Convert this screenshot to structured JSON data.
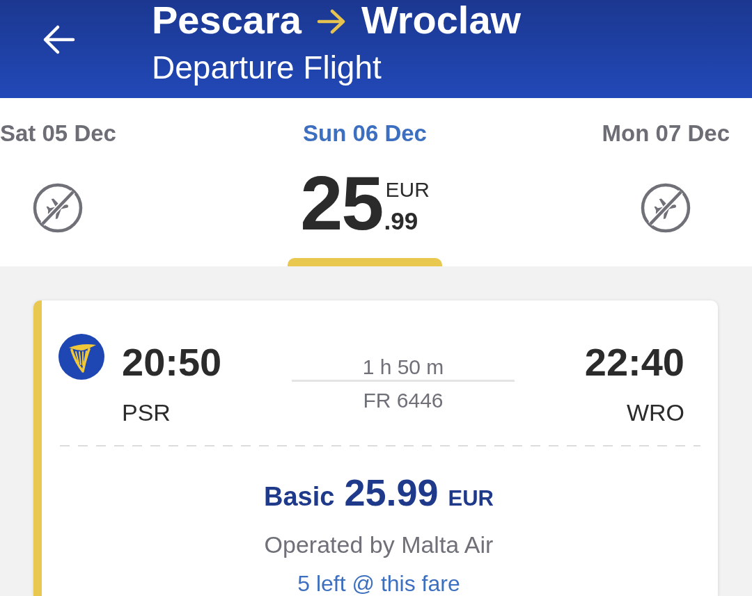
{
  "header": {
    "origin": "Pescara",
    "destination": "Wroclaw",
    "subtitle": "Departure Flight"
  },
  "dates": [
    {
      "label": "Sat 05 Dec",
      "selected": false,
      "kind": "no_flights"
    },
    {
      "label": "Sun 06 Dec",
      "selected": true,
      "kind": "price",
      "price_whole": "25",
      "currency": "EUR",
      "price_cents": ".99"
    },
    {
      "label": "Mon 07 Dec",
      "selected": false,
      "kind": "no_flights"
    }
  ],
  "flights": [
    {
      "selected": true,
      "departure_time": "20:50",
      "departure_airport": "PSR",
      "duration": "1 h 50 m",
      "flight_number": "FR 6446",
      "arrival_time": "22:40",
      "arrival_airport": "WRO",
      "fare": {
        "name": "Basic",
        "price": "25.99",
        "currency": "EUR"
      },
      "operator": "Operated by Malta Air",
      "availability": "5 left @ this fare"
    }
  ]
}
